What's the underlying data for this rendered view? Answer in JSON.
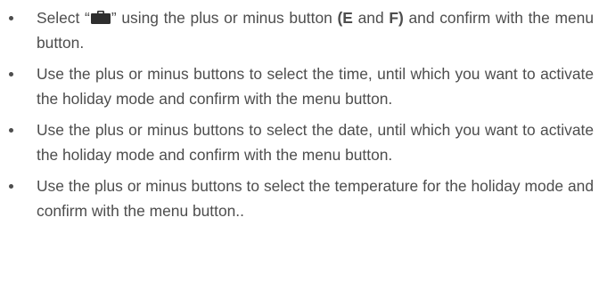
{
  "bullets": [
    {
      "parts": {
        "prefix": "Select “",
        "icon": "suitcase-icon",
        "after_icon": "” using the plus or minus button ",
        "bold_1": "(E",
        "mid_1": " and ",
        "bold_2": "F)",
        "suffix": "  and confirm with the menu button."
      }
    },
    {
      "text": "Use the plus or minus buttons to select the time, until which you want to activate the holiday mode and confirm with the menu button."
    },
    {
      "text": "Use the plus or minus buttons to select the date, until which you want to activate the holiday mode and confirm with the menu button."
    },
    {
      "text": "Use the plus or minus buttons to select the temperature for the holiday mode and confirm with the menu button.."
    }
  ]
}
